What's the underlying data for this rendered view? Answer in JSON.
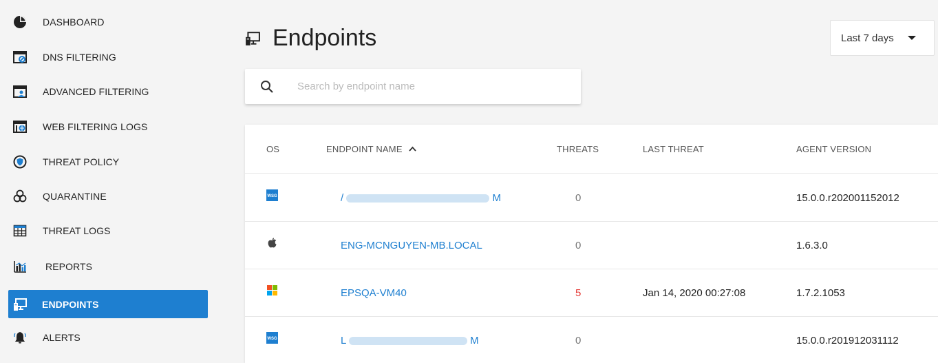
{
  "sidebar": {
    "items": [
      {
        "label": "DASHBOARD",
        "icon": "pie-chart-icon",
        "active": false
      },
      {
        "label": "DNS FILTERING",
        "icon": "dns-filter-icon",
        "active": false
      },
      {
        "label": "ADVANCED FILTERING",
        "icon": "advanced-filter-icon",
        "active": false
      },
      {
        "label": "WEB FILTERING LOGS",
        "icon": "web-logs-icon",
        "active": false
      },
      {
        "label": "THREAT POLICY",
        "icon": "shield-icon",
        "active": false
      },
      {
        "label": "QUARANTINE",
        "icon": "biohazard-icon",
        "active": false
      },
      {
        "label": "THREAT LOGS",
        "icon": "table-icon",
        "active": false
      },
      {
        "label": "REPORTS",
        "icon": "bar-chart-icon",
        "active": false
      },
      {
        "label": "ENDPOINTS",
        "icon": "endpoint-icon",
        "active": true
      },
      {
        "label": "ALERTS",
        "icon": "bell-icon",
        "active": false
      }
    ]
  },
  "header": {
    "title": "Endpoints",
    "title_icon": "endpoint-icon",
    "range_value": "Last 7 days"
  },
  "search": {
    "placeholder": "Search by endpoint name"
  },
  "table": {
    "columns": {
      "os": "OS",
      "name": "ENDPOINT NAME",
      "threats": "THREATS",
      "last_threat": "LAST THREAT",
      "agent_version": "AGENT VERSION"
    },
    "rows": [
      {
        "os": "wsg",
        "name_start": "/",
        "name_end": "M",
        "threats": "0",
        "last_threat": "",
        "agent_version": "15.0.0.r202001152012"
      },
      {
        "os": "apple",
        "name": "ENG-MCNGUYEN-MB.LOCAL",
        "threats": "0",
        "last_threat": "",
        "agent_version": "1.6.3.0"
      },
      {
        "os": "windows",
        "name": "EPSQA-VM40",
        "threats": "5",
        "last_threat": "Jan 14, 2020 00:27:08",
        "agent_version": "1.7.2.1053"
      },
      {
        "os": "wsg",
        "name_start": "L",
        "name_end": "M",
        "threats": "0",
        "last_threat": "",
        "agent_version": "15.0.0.r201912031112"
      }
    ]
  },
  "colors": {
    "accent": "#1e7fd0",
    "threat_red": "#e53935"
  }
}
